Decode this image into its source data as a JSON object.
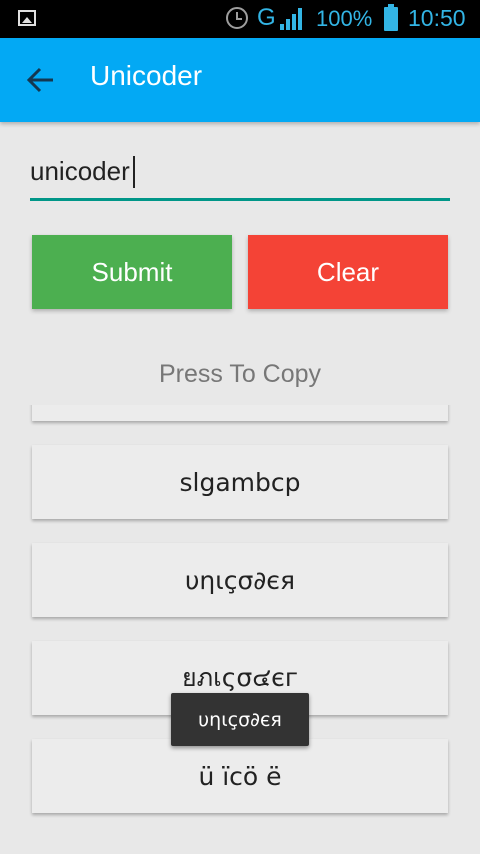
{
  "status_bar": {
    "network_type": "G",
    "battery_percent": "100%",
    "time": "10:50",
    "icons": [
      "image-icon",
      "alarm-icon",
      "signal-icon",
      "battery-icon"
    ]
  },
  "app_bar": {
    "title": "Unicoder",
    "back_icon": "arrow-back-icon",
    "color": "#03a9f4"
  },
  "input": {
    "value": "unicoder",
    "underline_color": "#009688"
  },
  "buttons": {
    "submit_label": "Submit",
    "submit_color": "#4caf50",
    "clear_label": "Clear",
    "clear_color": "#f44336"
  },
  "section_header": "Press To Copy",
  "results": [
    {
      "text": ""
    },
    {
      "text": "slgambcp"
    },
    {
      "text": "υηιçσ∂єя"
    },
    {
      "text": "ยภเςσ๔єг"
    },
    {
      "text": "ü ïcö ë"
    }
  ],
  "toast": {
    "text": "υηιçσ∂єя"
  }
}
